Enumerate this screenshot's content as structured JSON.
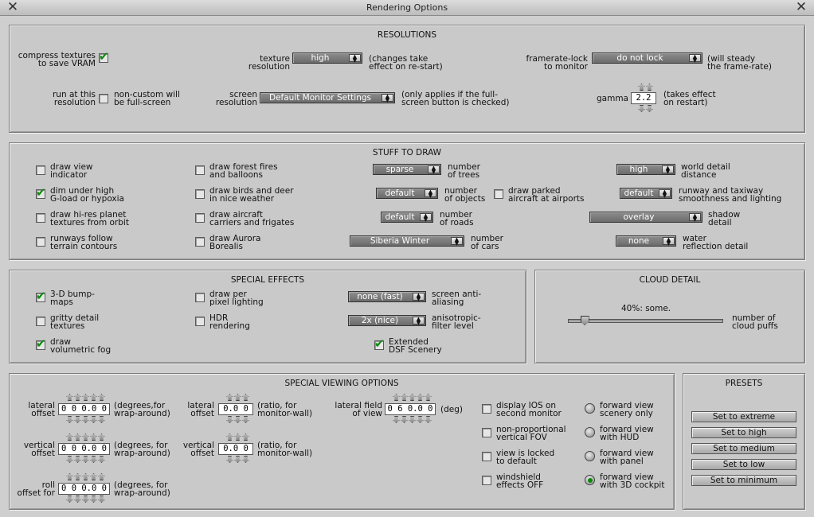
{
  "window": {
    "title": "Rendering Options"
  },
  "resolutions": {
    "title": "RESOLUTIONS",
    "compress": {
      "label1": "compress textures",
      "label2": "to save VRAM",
      "checked": true
    },
    "texture": {
      "label1": "texture",
      "label2": "resolution",
      "value": "high",
      "note1": "(changes take",
      "note2": "effect on re-start)"
    },
    "framerate": {
      "label1": "framerate-lock",
      "label2": "to monitor",
      "value": "do not lock",
      "note1": "(will steady",
      "note2": "the frame-rate)"
    },
    "runat": {
      "label1": "run at this",
      "label2": "resolution",
      "note1": "non-custom will",
      "note2": "be full-screen",
      "checked": false
    },
    "screen": {
      "label1": "screen",
      "label2": "resolution",
      "value": "Default Monitor Settings",
      "note1": "(only applies if the full-",
      "note2": "screen button is checked)"
    },
    "gamma": {
      "label": "gamma",
      "value": "2.2",
      "note1": "(takes effect",
      "note2": "on restart)"
    }
  },
  "stuff": {
    "title": "STUFF TO DRAW",
    "checks": [
      {
        "l1": "draw view",
        "l2": "indicator",
        "checked": false
      },
      {
        "l1": "dim under high",
        "l2": "G-load or hypoxia",
        "checked": true
      },
      {
        "l1": "draw hi-res planet",
        "l2": "textures from orbit",
        "checked": false
      },
      {
        "l1": "runways follow",
        "l2": "terrain contours",
        "checked": false
      },
      {
        "l1": "draw forest fires",
        "l2": "and balloons",
        "checked": false
      },
      {
        "l1": "draw birds and deer",
        "l2": "in nice weather",
        "checked": false
      },
      {
        "l1": "draw aircraft",
        "l2": "carriers and frigates",
        "checked": false
      },
      {
        "l1": "draw Aurora",
        "l2": "Borealis",
        "checked": false
      },
      {
        "l1": "draw parked",
        "l2": "aircraft at airports",
        "checked": false
      }
    ],
    "trees": {
      "value": "sparse",
      "l1": "number",
      "l2": "of trees"
    },
    "objects": {
      "value": "default",
      "l1": "number",
      "l2": "of objects"
    },
    "roads": {
      "value": "default",
      "l1": "number",
      "l2": "of roads"
    },
    "cars": {
      "value": "Siberia Winter",
      "l1": "number",
      "l2": "of cars"
    },
    "world": {
      "value": "high",
      "l1": "world detail",
      "l2": "distance"
    },
    "runway": {
      "value": "default",
      "l1": "runway and taxiway",
      "l2": "smoothness and lighting"
    },
    "shadow": {
      "value": "overlay",
      "l1": "shadow",
      "l2": "detail"
    },
    "water": {
      "value": "none",
      "l1": "water",
      "l2": "reflection detail"
    }
  },
  "effects": {
    "title": "SPECIAL EFFECTS",
    "checks": [
      {
        "l1": "3-D bump-",
        "l2": "maps",
        "checked": true
      },
      {
        "l1": "gritty detail",
        "l2": "textures",
        "checked": false
      },
      {
        "l1": "draw",
        "l2": "volumetric fog",
        "checked": true
      },
      {
        "l1": "draw per",
        "l2": "pixel lighting",
        "checked": false
      },
      {
        "l1": "HDR",
        "l2": "rendering",
        "checked": false
      },
      {
        "l1": "Extended",
        "l2": "DSF Scenery",
        "checked": true
      }
    ],
    "aa": {
      "value": "none (fast)",
      "l1": "screen anti-",
      "l2": "aliasing"
    },
    "aniso": {
      "value": "2x (nice)",
      "l1": "anisotropic-",
      "l2": "filter level"
    }
  },
  "cloud": {
    "title": "CLOUD DETAIL",
    "readout": "40%: some.",
    "level": 0.4,
    "l1": "number of",
    "l2": "cloud puffs"
  },
  "viewing": {
    "title": "SPECIAL VIEWING OPTIONS",
    "lateral": {
      "l1": "lateral",
      "l2": "offset",
      "value": "0 0 0.0 0",
      "n1": "(degrees,for",
      "n2": "wrap-around)"
    },
    "vertical": {
      "l1": "vertical",
      "l2": "offset",
      "value": "0 0 0.0 0",
      "n1": "(degrees, for",
      "n2": "wrap-around)"
    },
    "roll": {
      "l1": "roll",
      "l2": "offset for",
      "value": "0 0 0.0 0",
      "n1": "(degrees, for",
      "n2": "wrap-around)"
    },
    "lat2": {
      "l1": "lateral",
      "l2": "offset",
      "value": "0.0 0",
      "n1": "(ratio, for",
      "n2": "monitor-wall)"
    },
    "vert2": {
      "l1": "vertical",
      "l2": "offset",
      "value": "0.0 0",
      "n1": "(ratio, for",
      "n2": "monitor-wall)"
    },
    "fov": {
      "l1": "lateral field",
      "l2": "of view",
      "value": "0 6 0.0 0",
      "n1": "(deg)"
    },
    "checks": [
      {
        "l1": "display IOS on",
        "l2": "second monitor",
        "checked": false
      },
      {
        "l1": "non-proportional",
        "l2": "vertical FOV",
        "checked": false
      },
      {
        "l1": "view is locked",
        "l2": "to default",
        "checked": false
      },
      {
        "l1": "windshield",
        "l2": "effects OFF",
        "checked": false
      }
    ],
    "radios": [
      {
        "l1": "forward view",
        "l2": "scenery only",
        "selected": false
      },
      {
        "l1": "forward view",
        "l2": "with HUD",
        "selected": false
      },
      {
        "l1": "forward view",
        "l2": "with panel",
        "selected": false
      },
      {
        "l1": "forward view",
        "l2": "with 3D cockpit",
        "selected": true
      }
    ]
  },
  "presets": {
    "title": "PRESETS",
    "buttons": [
      "Set to extreme",
      "Set to high",
      "Set to medium",
      "Set to low",
      "Set to minimum"
    ]
  }
}
